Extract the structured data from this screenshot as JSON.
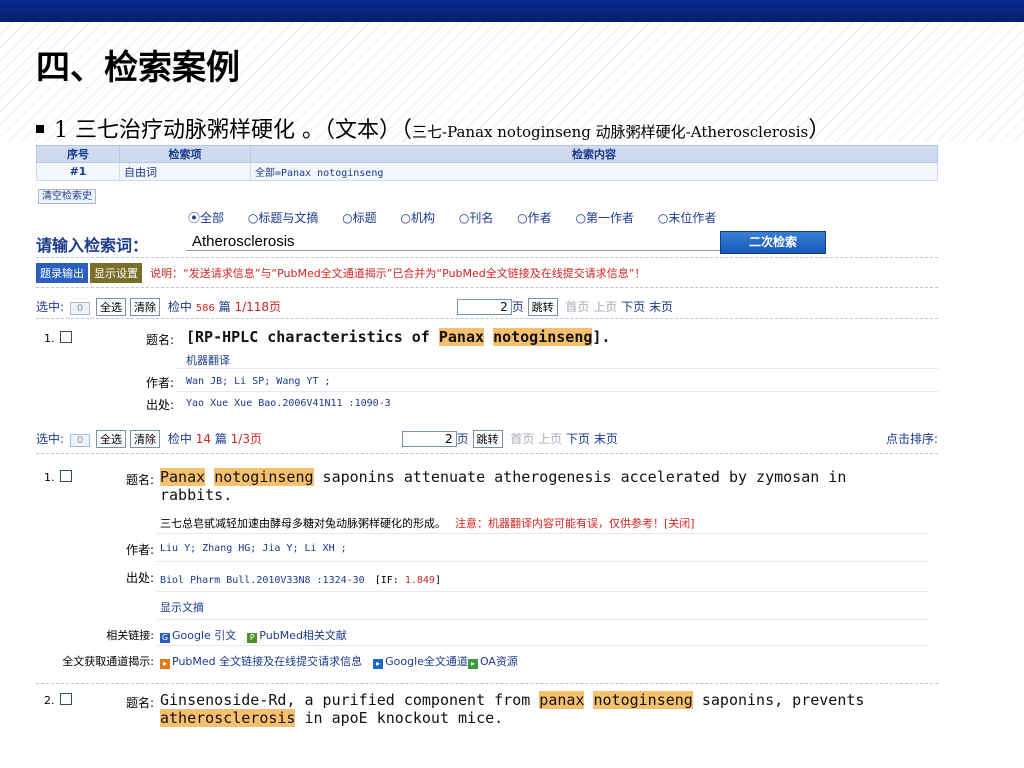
{
  "slide": {
    "title": "四、检索案例",
    "bullet_main": "1 三七治疗动脉粥样硬化 。（文本）（",
    "bullet_small": "三七-Panax notoginseng  动脉粥样硬化-Atherosclerosis",
    "bullet_close": "）"
  },
  "history": {
    "headers": [
      "序号",
      "检索项",
      "检索内容"
    ],
    "row": [
      "#1",
      "自由词",
      "全部=Panax notoginseng"
    ],
    "clear_label": "清空检索史"
  },
  "search": {
    "options": [
      "全部",
      "标题与文摘",
      "标题",
      "机构",
      "刊名",
      "作者",
      "第一作者",
      "末位作者"
    ],
    "selected": "全部",
    "label": "请输入检索词：",
    "value": "Atherosclerosis",
    "button": "二次检索"
  },
  "toolbar": {
    "export": "题录输出",
    "display": "显示设置",
    "notice": "说明：“发送请求信息”与“PubMed全文通道揭示”已合并为“PubMed全文链接及在线提交请求信息”！"
  },
  "pager1": {
    "selected_label": "选中:",
    "selected_count": "0",
    "select_all": "全选",
    "clear": "清除",
    "hits_prefix": "检中",
    "hits": "586",
    "hits_unit": "篇",
    "page_info": "1/118页",
    "page_input": "2",
    "page_suffix": "页",
    "jump": "跳转",
    "nav": [
      "首页",
      "上页",
      "下页",
      "末页"
    ]
  },
  "record_a": {
    "num": "1.",
    "title_label": "题名:",
    "title_pre": "[RP-HPLC characteristics of ",
    "hl1": "Panax",
    "hl2": "notoginseng",
    "title_post": "].",
    "mt": "机器翻译",
    "author_label": "作者:",
    "authors": "Wan JB; Li SP; Wang YT ;",
    "source_label": "出处:",
    "source": "Yao Xue Xue Bao.2006V41N11 :1090-3"
  },
  "pager2": {
    "selected_label": "选中:",
    "selected_count": "0",
    "select_all": "全选",
    "clear": "清除",
    "hits_prefix": "检中",
    "hits": "14",
    "hits_unit": "篇",
    "page_info": "1/3页",
    "page_input": "2",
    "page_suffix": "页",
    "jump": "跳转",
    "nav": [
      "首页",
      "上页",
      "下页",
      "末页"
    ],
    "sort": "点击排序:"
  },
  "record_b": {
    "num": "1.",
    "title_label": "题名:",
    "hl1": "Panax",
    "hl2": "notoginseng",
    "title_rest": " saponins attenuate atherogenesis accelerated by zymosan in rabbits.",
    "translation": "三七总皂甙减轻加速由酵母多糖对兔动脉粥样硬化的形成。",
    "warning": "注意：机器翻译内容可能有误，仅供参考！",
    "close": "关闭",
    "author_label": "作者:",
    "authors": "Liu Y; Zhang HG; Jia Y; Li XH ;",
    "source_label": "出处:",
    "source": "Biol Pharm Bull.2010V33N8 :1324-30",
    "if_label": "[IF:",
    "if_value": "1.849",
    "if_close": "]",
    "show_abstract": "显示文摘",
    "links_label": "相关链接:",
    "google_cite": "Google 引文",
    "pubmed_related": "PubMed相关文献",
    "fulltext_label": "全文获取通道揭示:",
    "pubmed_full": "PubMed 全文链接及在线提交请求信息",
    "google_full": "Google全文通道",
    "oa": "OA资源"
  },
  "record_c": {
    "num": "2.",
    "title_label": "题名:",
    "title_pre": "Ginsenoside-Rd, a purified component from ",
    "hl1": "panax",
    "hl2": "notoginseng",
    "title_mid": " saponins, prevents",
    "hl3": "atherosclerosis",
    "title_post": " in apoE knockout mice."
  }
}
